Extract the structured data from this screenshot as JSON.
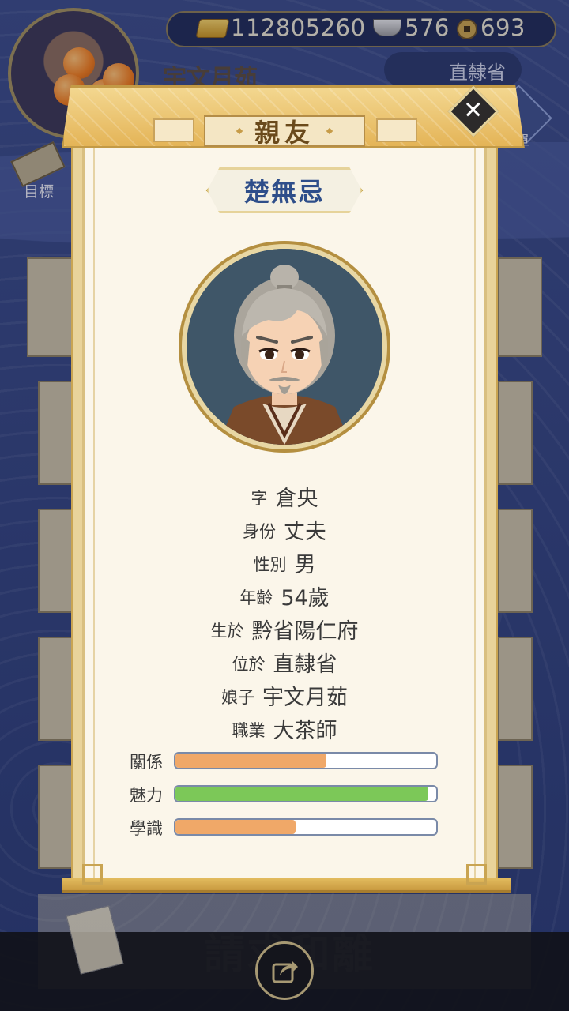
{
  "resources": {
    "gold": "112805260",
    "silver": "576",
    "coins": "693"
  },
  "player": {
    "name": "宇文月茹",
    "province": "直隸省"
  },
  "hud": {
    "menu_label": "菜單",
    "goal_label": "目標"
  },
  "background_action": "請求和離",
  "dialog": {
    "title": "親友",
    "person_name": "楚無忌",
    "info": [
      {
        "key": "字",
        "value": "倉央"
      },
      {
        "key": "身份",
        "value": "丈夫"
      },
      {
        "key": "性別",
        "value": "男"
      },
      {
        "key": "年齡",
        "value": "54歲"
      },
      {
        "key": "生於",
        "value": "黔省陽仁府"
      },
      {
        "key": "位於",
        "value": "直隸省"
      },
      {
        "key": "娘子",
        "value": "宇文月茹"
      },
      {
        "key": "職業",
        "value": "大茶師"
      }
    ],
    "stats": [
      {
        "label": "關係",
        "value": 0.58,
        "color": "#f0a868"
      },
      {
        "label": "魅力",
        "value": 0.97,
        "color": "#7cc858"
      },
      {
        "label": "學識",
        "value": 0.46,
        "color": "#f0a868"
      }
    ]
  },
  "icons": {
    "close": "close-icon",
    "share": "share-icon",
    "gold": "gold-ingot-icon",
    "silver": "silver-ingot-icon",
    "coin": "copper-coin-icon"
  }
}
